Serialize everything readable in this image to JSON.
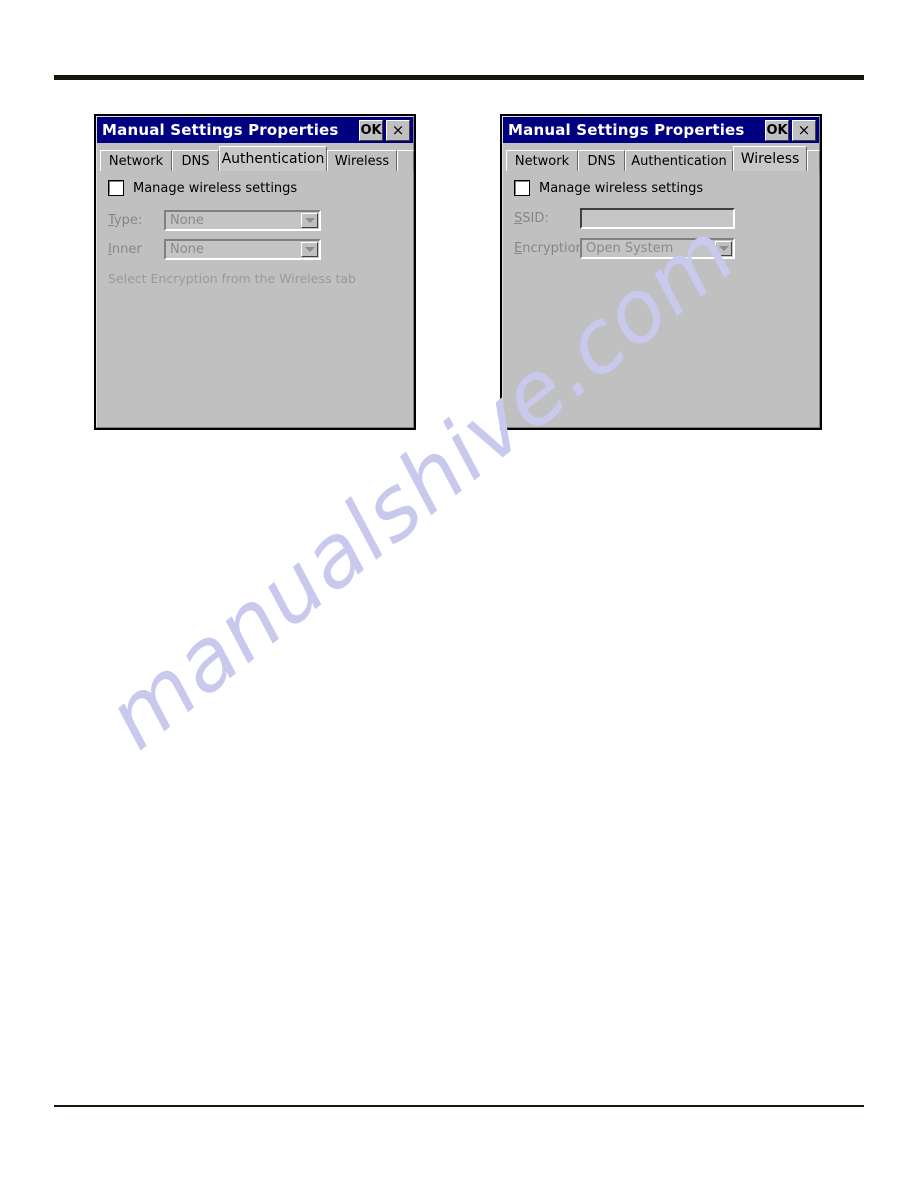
{
  "page": {
    "watermark": "manualshive.com",
    "rule_color": "#14170a"
  },
  "dialogs": [
    {
      "id": "authentication-dialog",
      "title": "Manual Settings Properties",
      "titlebar": {
        "ok_label": "OK",
        "close_label": "×"
      },
      "tabs": [
        {
          "label": "Network",
          "active": false
        },
        {
          "label": "DNS",
          "active": false
        },
        {
          "label": "Authentication",
          "active": true
        },
        {
          "label": "Wireless",
          "active": false
        }
      ],
      "checkbox": {
        "label": "Manage wireless settings",
        "checked": false
      },
      "fields": [
        {
          "name": "type",
          "label_accel": "T",
          "label_rest": "ype:",
          "control": "combo",
          "value": "None",
          "disabled": true
        },
        {
          "name": "inner",
          "label_accel": "I",
          "label_rest": "nner",
          "control": "combo",
          "value": "None",
          "disabled": true
        }
      ],
      "hint": "Select Encryption from the Wireless tab"
    },
    {
      "id": "wireless-dialog",
      "title": "Manual Settings Properties",
      "titlebar": {
        "ok_label": "OK",
        "close_label": "×"
      },
      "tabs": [
        {
          "label": "Network",
          "active": false
        },
        {
          "label": "DNS",
          "active": false
        },
        {
          "label": "Authentication",
          "active": false
        },
        {
          "label": "Wireless",
          "active": true
        }
      ],
      "checkbox": {
        "label": "Manage wireless settings",
        "checked": false
      },
      "fields": [
        {
          "name": "ssid",
          "label_accel": "S",
          "label_rest": "SID:",
          "control": "text",
          "value": "",
          "disabled": true
        },
        {
          "name": "encryption",
          "label_accel": "E",
          "label_rest": "ncryption:",
          "control": "combo",
          "value": "Open System",
          "disabled": true
        }
      ],
      "hint": ""
    }
  ],
  "colors": {
    "titlebar": "#000080",
    "dialog_face": "#c0c0c0",
    "disabled_text": "#8a8a8a",
    "watermark": "#c9c9ee"
  }
}
